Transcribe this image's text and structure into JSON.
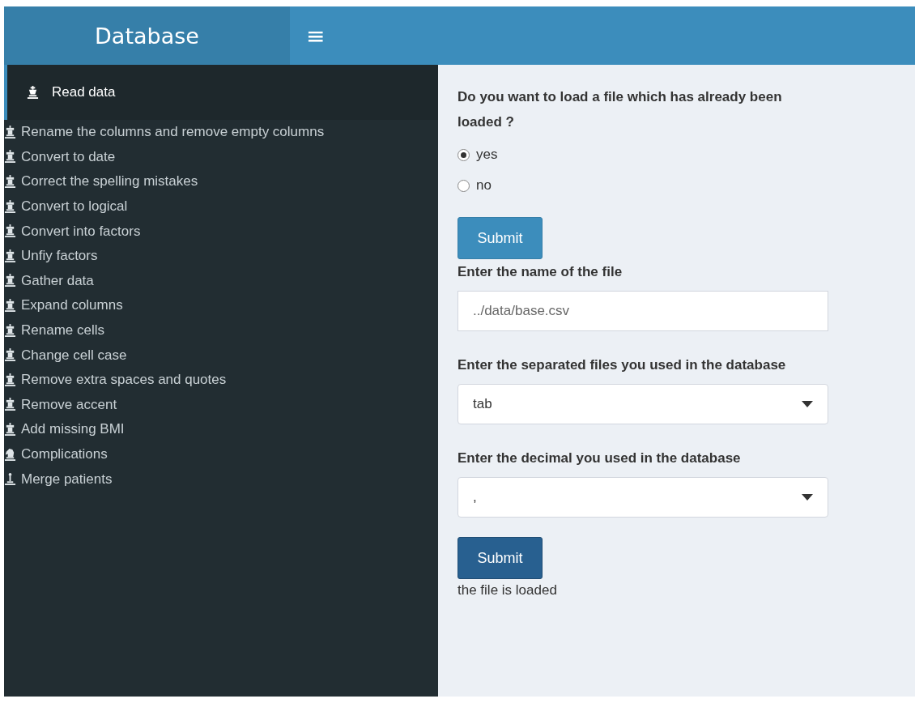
{
  "header": {
    "title": "Database",
    "menu_glyph": "≡"
  },
  "sidebar": {
    "items": [
      {
        "label": "Read data",
        "kind": "king",
        "selected": true
      },
      {
        "label": "Rename the columns and remove empty columns",
        "kind": "rook",
        "selected": false
      },
      {
        "label": "Convert to date",
        "kind": "rook",
        "selected": false
      },
      {
        "label": "Correct the spelling mistakes",
        "kind": "rook",
        "selected": false
      },
      {
        "label": "Convert to logical",
        "kind": "rook",
        "selected": false
      },
      {
        "label": "Convert into factors",
        "kind": "rook",
        "selected": false
      },
      {
        "label": "Unfiy factors",
        "kind": "rook",
        "selected": false
      },
      {
        "label": "Gather data",
        "kind": "rook",
        "selected": false
      },
      {
        "label": "Expand columns",
        "kind": "rook",
        "selected": false
      },
      {
        "label": "Rename cells",
        "kind": "rook",
        "selected": false
      },
      {
        "label": "Change cell case",
        "kind": "rook",
        "selected": false
      },
      {
        "label": "Remove extra spaces and quotes",
        "kind": "rook",
        "selected": false
      },
      {
        "label": "Remove accent",
        "kind": "rook",
        "selected": false
      },
      {
        "label": "Add missing BMI",
        "kind": "rook",
        "selected": false
      },
      {
        "label": "Complications",
        "kind": "knight",
        "selected": false
      },
      {
        "label": "Merge patients",
        "kind": "pawn",
        "selected": false
      }
    ]
  },
  "form": {
    "question": "Do you want to load a file which has already been loaded ?",
    "options": [
      {
        "label": "yes",
        "selected": true
      },
      {
        "label": "no",
        "selected": false
      }
    ],
    "submit_1": {
      "label": "Submit",
      "focused": false
    },
    "file_name": {
      "label": "Enter the name of the file",
      "value": "../data/base.csv"
    },
    "separator": {
      "label": "Enter the separated files you used in the database",
      "value": "tab"
    },
    "decimal": {
      "label": "Enter the decimal you used in the database",
      "value": ","
    },
    "submit_2": {
      "label": "Submit",
      "focused": true
    },
    "status": "the file is loaded"
  }
}
